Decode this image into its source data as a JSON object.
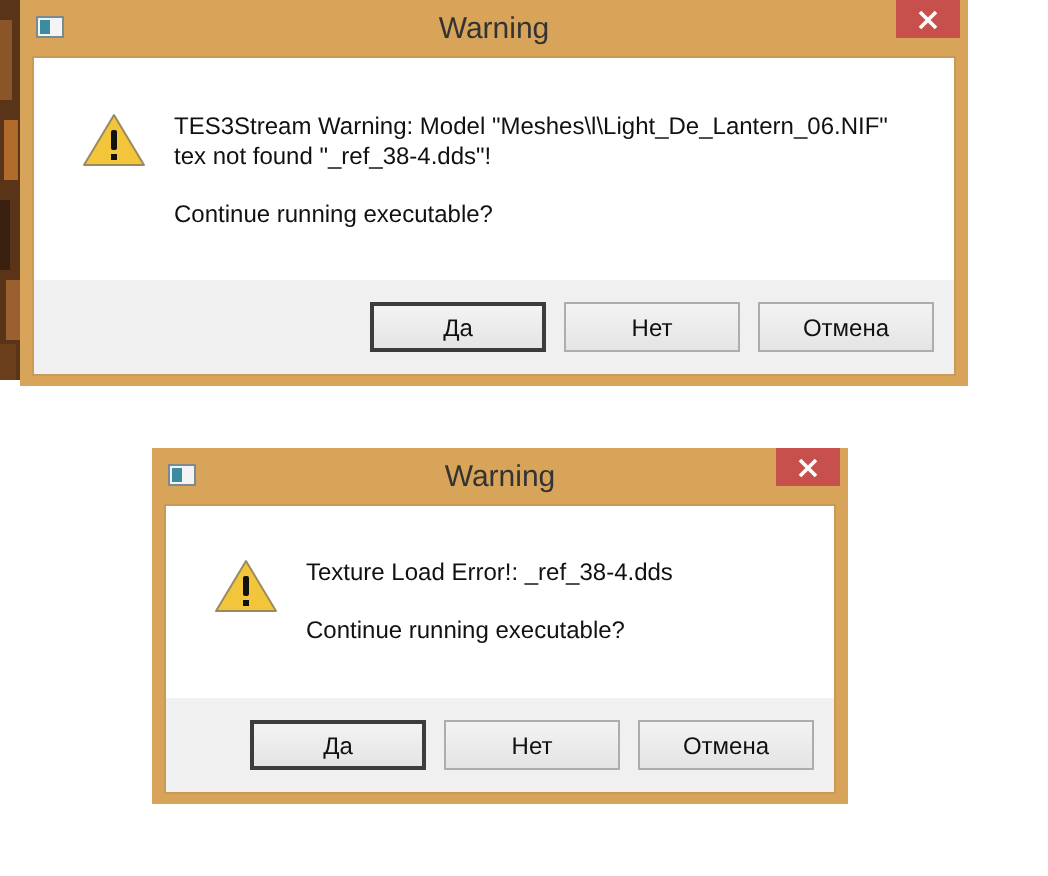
{
  "dialogs": [
    {
      "title": "Warning",
      "message": "TES3Stream Warning: Model \"Meshes\\l\\Light_De_Lantern_06.NIF\" tex not found \"_ref_38-4.dds\"!",
      "question": "Continue running executable?",
      "buttons": [
        {
          "label": "Да",
          "default": true
        },
        {
          "label": "Нет",
          "default": false
        },
        {
          "label": "Отмена",
          "default": false
        }
      ]
    },
    {
      "title": "Warning",
      "message": "Texture Load Error!: _ref_38-4.dds",
      "question": "Continue running executable?",
      "buttons": [
        {
          "label": "Да",
          "default": true
        },
        {
          "label": "Нет",
          "default": false
        },
        {
          "label": "Отмена",
          "default": false
        }
      ]
    }
  ]
}
